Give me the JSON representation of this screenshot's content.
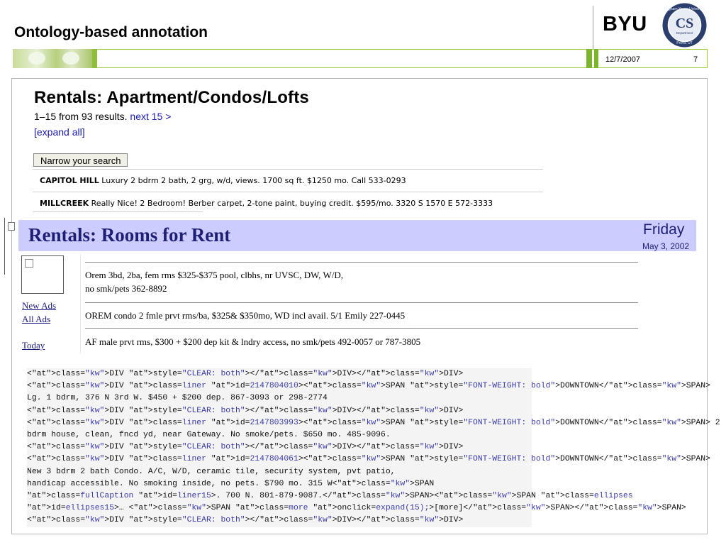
{
  "header": {
    "title": "Ontology-based annotation",
    "brand": "BYU",
    "seal_text": "CS",
    "seal_sub": "Department"
  },
  "footer_band": {
    "date": "12/7/2007",
    "slide_number": "7"
  },
  "screenshot1": {
    "title": "Rentals: Apartment/Condos/Lofts",
    "count_text": "1–15 from 93 results.",
    "next_link": "next 15 >",
    "expand": "[expand all]",
    "narrow_button": "Narrow your search",
    "rows": [
      {
        "place": "CAPITOL HILL",
        "text": " Luxury 2 bdrm 2 bath, 2 grg, w/d, views. 1700 sq ft. $1250 mo. Call 533-0293"
      },
      {
        "place": "MILLCREEK",
        "text": " Really Nice! 2 Bedroom! Berber carpet, 2-tone paint, buying credit. $595/mo. 3320 S 1570 E 572-3333"
      }
    ]
  },
  "screenshot2": {
    "title": "Rentals: Rooms for Rent",
    "day": "Friday",
    "date": "May 3, 2002",
    "links": [
      "New Ads",
      "All Ads",
      "Today"
    ],
    "ads": [
      {
        "line1": "Orem 3bd, 2ba, fem rms $325-$375 pool, clbhs, nr UVSC, DW, W/D,",
        "line2": "no smk/pets 362-8892"
      },
      {
        "line1": "OREM condo 2 fmle prvt rms/ba, $325& $350mo, WD incl avail. 5/1 Emily 227-0445",
        "line2": ""
      },
      {
        "line1": "AF male prvt rms, $300 + $200 dep kit & lndry access, no smk/pets 492-0057 or 787-3805",
        "line2": ""
      }
    ]
  },
  "code_lines": [
    "<DIV style=\"CLEAR: both\"></DIV></DIV>",
    "<DIV class=liner id=2147804010><SPAN style=\"FONT-WEIGHT: bold\">DOWNTOWN</SPAN>",
    "Lg. 1 bdrm, 376 N 3rd W. $450 + $200 dep. 867-3093 or 298-2774",
    "<DIV style=\"CLEAR: both\"></DIV></DIV>",
    "<DIV class=liner id=2147803993><SPAN style=\"FONT-WEIGHT: bold\">DOWNTOWN</SPAN> 2",
    "bdrm house, clean, fncd yd, near Gateway. No smoke/pets. $650 mo. 485-9096.",
    "<DIV style=\"CLEAR: both\"></DIV></DIV>",
    "<DIV class=liner id=2147804061><SPAN style=\"FONT-WEIGHT: bold\">DOWNTOWN</SPAN>",
    "New 3 bdrm 2 bath Condo. A/C, W/D, ceramic tile, security system, pvt patio,",
    "handicap accessible. No smoking inside, no pets. $790 mo. 315 W<SPAN",
    "class=fullCaption id=liner15>. 700 N. 801-879-9087.</SPAN><SPAN class=ellipses",
    "id=ellipses15>… <SPAN class=more onclick=expand(15);>[more]</SPAN></SPAN>",
    "<DIV style=\"CLEAR: both\"></DIV></DIV>"
  ]
}
